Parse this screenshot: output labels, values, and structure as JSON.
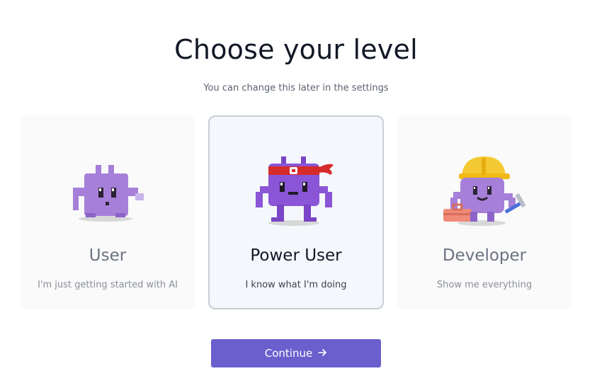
{
  "header": {
    "title": "Choose your level",
    "subtitle": "You can change this later in the settings"
  },
  "levels": [
    {
      "name": "User",
      "description": "I'm just getting started with AI",
      "icon": "purple-monster-icon",
      "selected": false
    },
    {
      "name": "Power User",
      "description": "I know what I'm doing",
      "icon": "purple-monster-headband-icon",
      "selected": true
    },
    {
      "name": "Developer",
      "description": "Show me everything",
      "icon": "purple-monster-hardhat-icon",
      "selected": false
    }
  ],
  "continue_button": {
    "label": "Continue",
    "icon": "arrow-right-icon"
  },
  "colors": {
    "accent": "#6a5fcd",
    "mascot": "#9b6fd8",
    "selected_card_bg": "#f4f7fc",
    "selected_card_border": "#c9ced6"
  }
}
